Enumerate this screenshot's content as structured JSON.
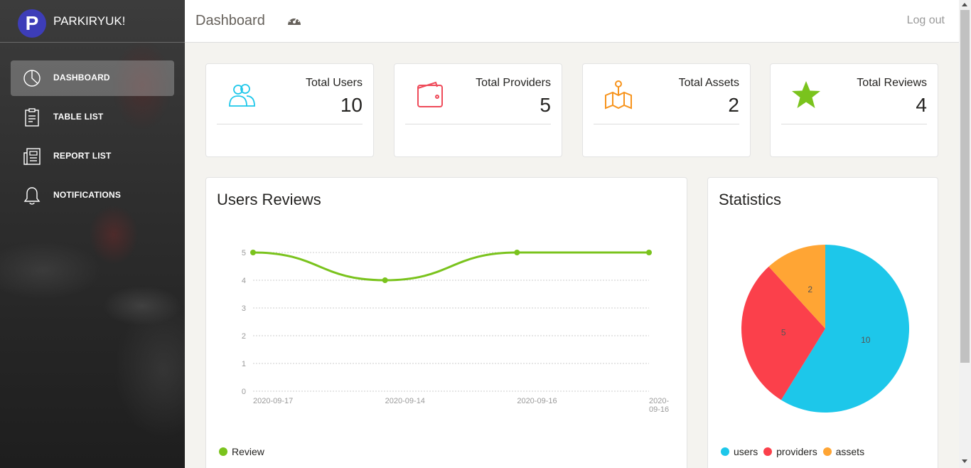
{
  "brand": {
    "logo_letter": "P",
    "name": "PARKIRYUK!"
  },
  "sidebar": {
    "items": [
      {
        "label": "DASHBOARD",
        "icon": "pie-chart-icon",
        "active": true
      },
      {
        "label": "TABLE LIST",
        "icon": "clipboard-icon",
        "active": false
      },
      {
        "label": "REPORT LIST",
        "icon": "newspaper-icon",
        "active": false
      },
      {
        "label": "NOTIFICATIONS",
        "icon": "bell-icon",
        "active": false
      }
    ]
  },
  "header": {
    "title": "Dashboard",
    "icon": "dashboard-gauge-icon",
    "logout_label": "Log out"
  },
  "stats": [
    {
      "label": "Total Users",
      "value": "10",
      "icon": "users-icon",
      "color": "#1dc7ea"
    },
    {
      "label": "Total Providers",
      "value": "5",
      "icon": "wallet-icon",
      "color": "#ef4b5a"
    },
    {
      "label": "Total Assets",
      "value": "2",
      "icon": "map-pin-icon",
      "color": "#f7941d"
    },
    {
      "label": "Total Reviews",
      "value": "4",
      "icon": "star-icon",
      "color": "#7ac31d"
    }
  ],
  "reviews_card": {
    "title": "Users Reviews",
    "legend": [
      {
        "label": "Review",
        "color": "#7ac31d"
      }
    ]
  },
  "stats_card": {
    "title": "Statistics",
    "legend": [
      {
        "label": "users",
        "color": "#1dc7ea"
      },
      {
        "label": "providers",
        "color": "#fb404b"
      },
      {
        "label": "assets",
        "color": "#ffa534"
      }
    ]
  },
  "chart_data": [
    {
      "type": "line",
      "title": "Users Reviews",
      "categories": [
        "2020-09-17",
        "2020-09-14",
        "2020-09-16",
        "2020-09-16"
      ],
      "series": [
        {
          "name": "Review",
          "values": [
            5,
            4,
            5,
            5
          ],
          "color": "#7ac31d"
        }
      ],
      "ylim": [
        0,
        5
      ],
      "yticks": [
        0,
        1,
        2,
        3,
        4,
        5
      ],
      "grid": true,
      "legend": "bottom-left"
    },
    {
      "type": "pie",
      "title": "Statistics",
      "labels": [
        "users",
        "providers",
        "assets"
      ],
      "values": [
        10,
        5,
        2
      ],
      "colors": [
        "#1dc7ea",
        "#fb404b",
        "#ffa534"
      ],
      "legend": "bottom-left"
    }
  ]
}
